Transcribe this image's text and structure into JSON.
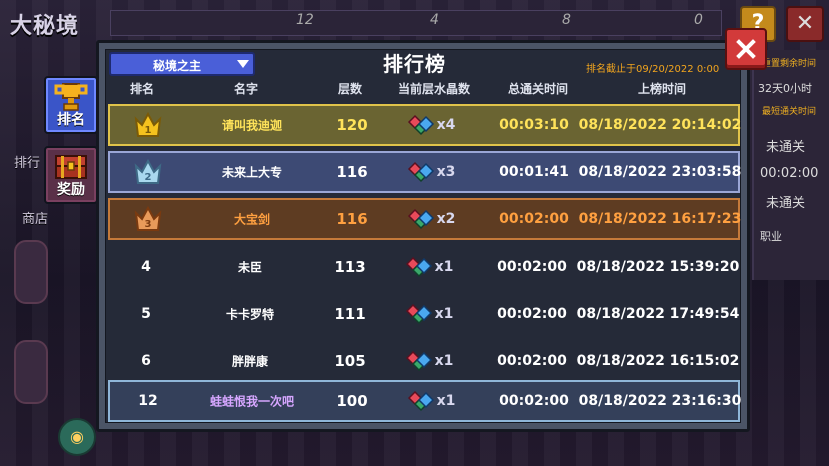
{
  "background": {
    "title": "大秘境",
    "top_numbers": [
      "12",
      "4",
      "8",
      "0"
    ],
    "side_labels": [
      "排行",
      "商店"
    ],
    "right_panel": {
      "small_lines": [
        "重置剩余时间",
        "最短通关时间"
      ],
      "lines": [
        "32天0小时",
        "未通关",
        "00:02:00",
        "未通关",
        "职业"
      ]
    },
    "help_label": "?",
    "exit_label": "✕"
  },
  "tabs": [
    {
      "label": "排名",
      "icon": "trophy-icon",
      "active": true
    },
    {
      "label": "奖励",
      "icon": "chest-icon",
      "active": false
    }
  ],
  "modal": {
    "title": "排行榜",
    "dropdown_label": "秘境之主",
    "deadline": "排名截止于09/20/2022 0:00",
    "headers": {
      "rank": "排名",
      "name": "名字",
      "floor": "层数",
      "crystals": "当前层水晶数",
      "total_time": "总通关时间",
      "listed_time": "上榜时间"
    },
    "rows": [
      {
        "rank": "1",
        "name": "请叫我迪迦",
        "floor": "120",
        "crystals": "x4",
        "total_time": "00:03:10",
        "listed_time": "08/18/2022 20:14:02"
      },
      {
        "rank": "2",
        "name": "未来上大专",
        "floor": "116",
        "crystals": "x3",
        "total_time": "00:01:41",
        "listed_time": "08/18/2022 23:03:58"
      },
      {
        "rank": "3",
        "name": "大宝剑",
        "floor": "116",
        "crystals": "x2",
        "total_time": "00:02:00",
        "listed_time": "08/18/2022 16:17:23"
      },
      {
        "rank": "4",
        "name": "未臣",
        "floor": "113",
        "crystals": "x1",
        "total_time": "00:02:00",
        "listed_time": "08/18/2022 15:39:20"
      },
      {
        "rank": "5",
        "name": "卡卡罗特",
        "floor": "111",
        "crystals": "x1",
        "total_time": "00:02:00",
        "listed_time": "08/18/2022 17:49:54"
      },
      {
        "rank": "6",
        "name": "胖胖康",
        "floor": "105",
        "crystals": "x1",
        "total_time": "00:02:00",
        "listed_time": "08/18/2022 16:15:02"
      },
      {
        "rank": "12",
        "name": "蛙蛙恨我一次吧",
        "floor": "100",
        "crystals": "x1",
        "total_time": "00:02:00",
        "listed_time": "08/18/2022 23:16:30"
      }
    ]
  },
  "colors": {
    "gold_row": "#6a6432",
    "silver_row": "#3d4a74",
    "bronze_row": "#5e3c22",
    "own_row": "#34405a",
    "close_button": "#d23a3a",
    "deadline_text": "#f2a51e"
  }
}
